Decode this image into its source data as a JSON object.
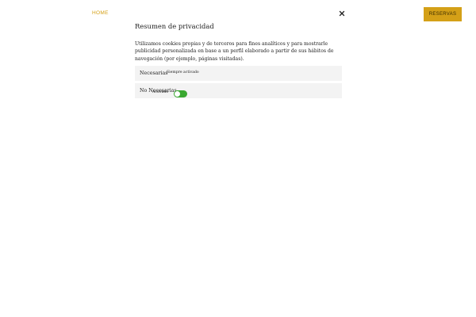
{
  "header": {
    "home_label": "HOME",
    "reservas_label": "RESERVAS"
  },
  "modal": {
    "title": "Resumen de privacidad",
    "description": "Utilizamos cookies propias y de terceros para fines analíticos y para mostrarle publicidad personalizada en base a un perfil elaborado a partir de sus hábitos de navegación (por ejemplo, páginas visitadas).",
    "close_icon": "close-icon",
    "categories": [
      {
        "label": "Necesarias",
        "status": "Siempre activado"
      },
      {
        "label": "No Necesarias",
        "toggle_text": "Activado",
        "enabled": true
      }
    ]
  },
  "colors": {
    "accent": "#d4a017",
    "home_text": "#d4a017",
    "button_text": "#3a2c00",
    "toggle_on": "#3aa830",
    "panel_bg": "#f3f3f3"
  }
}
